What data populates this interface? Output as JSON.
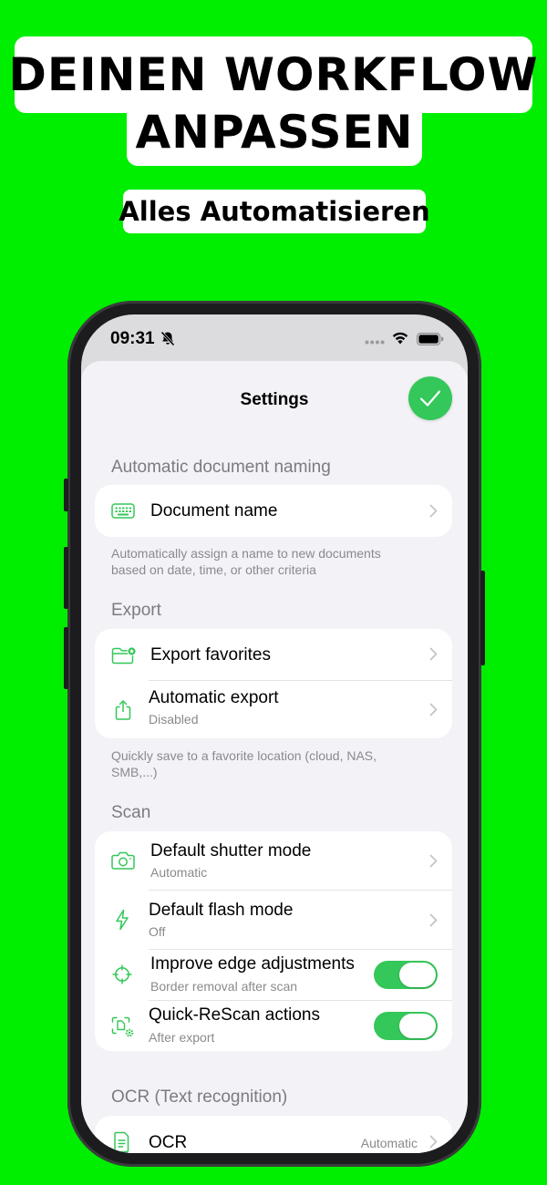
{
  "promo": {
    "headline_line1": "DEINEN WORKFLOW",
    "headline_line2": "ANPASSEN",
    "subheadline": "Alles Automatisieren",
    "background_color": "#00ee00"
  },
  "status_bar": {
    "time": "09:31",
    "icons": [
      "bell-slash-icon",
      "signal-dots-icon",
      "wifi-icon",
      "battery-icon"
    ]
  },
  "nav": {
    "title": "Settings",
    "done_icon": "checkmark-icon",
    "accent_color": "#34c759"
  },
  "sections": {
    "naming": {
      "header": "Automatic document naming",
      "rows": [
        {
          "label": "Document name",
          "icon": "keyboard-icon"
        }
      ],
      "footer": "Automatically assign a name to new documents based on date, time, or other criteria"
    },
    "export": {
      "header": "Export",
      "rows": [
        {
          "label": "Export favorites",
          "icon": "folder-star-icon"
        },
        {
          "label": "Automatic export",
          "sublabel": "Disabled",
          "icon": "share-icon"
        }
      ],
      "footer": "Quickly save to a favorite location (cloud, NAS, SMB,...)"
    },
    "scan": {
      "header": "Scan",
      "rows": [
        {
          "label": "Default shutter mode",
          "sublabel": "Automatic",
          "icon": "camera-icon"
        },
        {
          "label": "Default flash mode",
          "sublabel": "Off",
          "icon": "bolt-icon"
        },
        {
          "label": "Improve edge adjustments",
          "sublabel": "Border removal after scan",
          "icon": "crosshair-icon",
          "toggle": true
        },
        {
          "label": "Quick-ReScan actions",
          "sublabel": "After export",
          "icon": "rescan-gear-icon",
          "toggle": true
        }
      ]
    },
    "ocr": {
      "header": "OCR (Text recognition)",
      "rows": [
        {
          "label": "OCR",
          "value": "Automatic",
          "icon": "document-text-icon"
        }
      ]
    }
  }
}
